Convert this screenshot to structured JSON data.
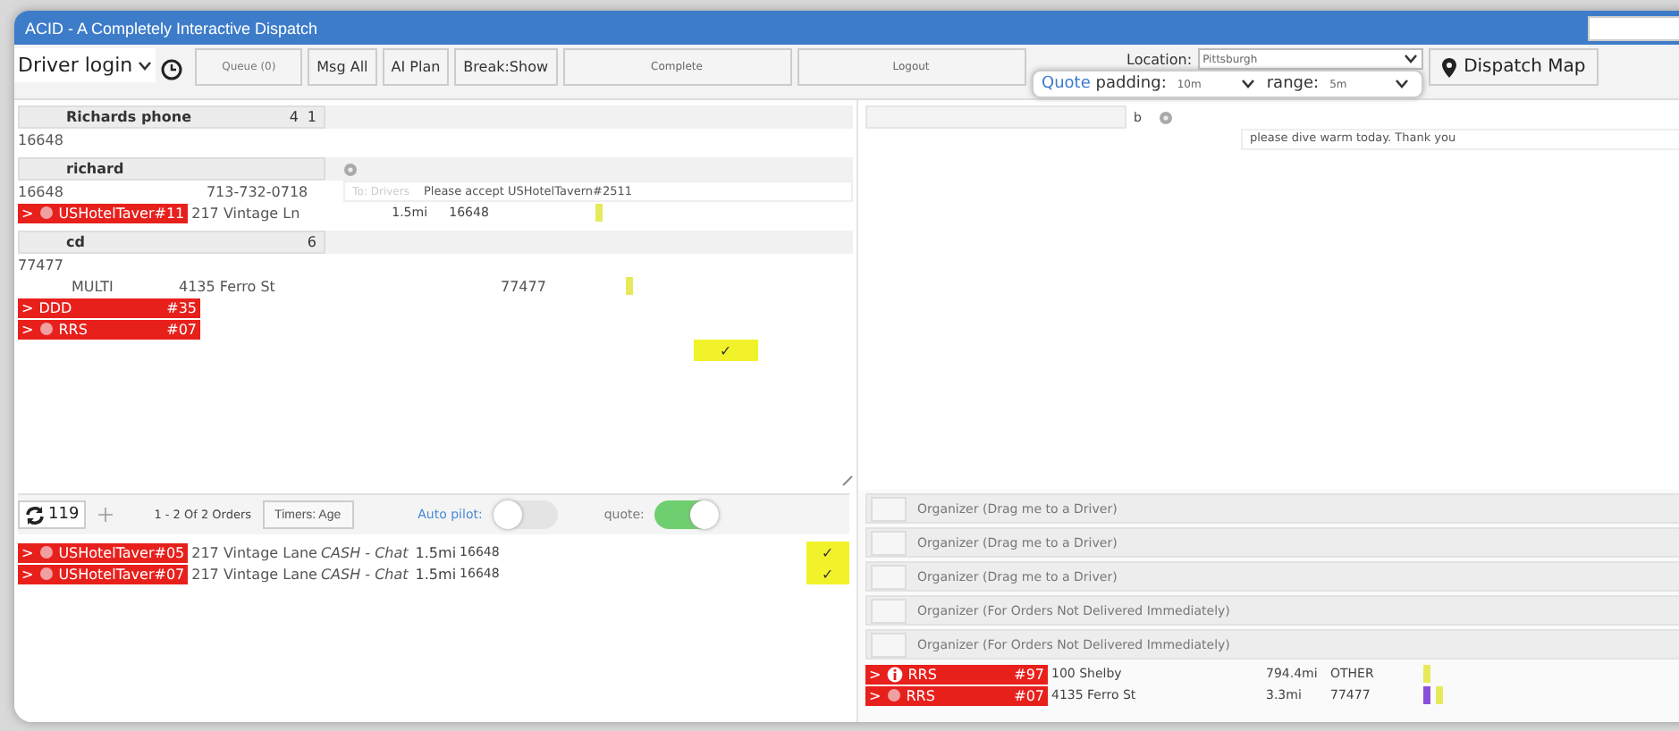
{
  "window": {
    "title": "ACID - A Completely Interactive Dispatch"
  },
  "toolbar": {
    "driver_login": "Driver login",
    "buttons": [
      {
        "label": "Queue (0)",
        "kind": "faint"
      },
      {
        "label": "Msg All",
        "kind": "plain"
      },
      {
        "label": "AI Plan",
        "kind": "plain"
      },
      {
        "label": "Break:Show",
        "kind": "plain"
      },
      {
        "label": "Complete",
        "kind": "wide"
      },
      {
        "label": "Logout",
        "kind": "wide"
      }
    ],
    "location_label": "Location:",
    "location_value": "Pittsburgh",
    "map_button": "Dispatch Map",
    "quote_word": "Quote",
    "padding_label": "padding:",
    "padding_value": "10m",
    "range_label": "range:",
    "range_value": "5m"
  },
  "drivers": [
    {
      "name": "Richards phone",
      "counts": [
        "4",
        "1"
      ],
      "lines": [
        {
          "cells": [
            "16648"
          ]
        }
      ]
    },
    {
      "name": "richard",
      "lines": [
        {
          "cells": [
            "16648",
            "713-732-0718"
          ]
        }
      ],
      "message": {
        "from": "To: Drivers",
        "text": "Please accept USHotelTavern#2511"
      },
      "orders": [
        {
          "arrow": ">",
          "kind": "dot",
          "tag": "USHotelTaver#11",
          "address": "217 Vintage Ln",
          "distance": "1.5mi",
          "zip": "16648",
          "flags": [
            {
              "color": "#e6ea5a"
            }
          ]
        }
      ]
    },
    {
      "name": "cd",
      "counts": [
        "6"
      ],
      "lines": [
        {
          "cells": [
            "77477"
          ]
        },
        {
          "cells": [
            "MULTI",
            "4135 Ferro St",
            "77477"
          ],
          "flags": [
            {
              "color": "#e6ea5a"
            }
          ]
        }
      ],
      "orders": [
        {
          "arrow": ">",
          "kind": "plain",
          "tag": "DDD",
          "number": "#35"
        },
        {
          "arrow": ">",
          "kind": "dot",
          "tag": "RRS",
          "number": "#07"
        }
      ],
      "check": "✓"
    }
  ],
  "chat": {
    "b": "b",
    "message": "please dive warm today. Thank you"
  },
  "orders_bar": {
    "refresh_count": "119",
    "pager": "1 - 2 Of 2 Orders",
    "timers": "Timers: Age",
    "toggles": [
      {
        "label": "Auto pilot:",
        "on": false
      },
      {
        "label": "quote:",
        "on": true
      }
    ]
  },
  "orders": [
    {
      "arrow": ">",
      "kind": "dot",
      "tag": "USHotelTaver#05",
      "address": "217 Vintage Lane",
      "payment": "CASH - Chat",
      "distance": "1.5mi",
      "zip": "16648",
      "check": "✓"
    },
    {
      "arrow": ">",
      "kind": "dot",
      "tag": "USHotelTaver#07",
      "address": "217 Vintage Lane",
      "payment": "CASH - Chat",
      "distance": "1.5mi",
      "zip": "16648",
      "check": "✓"
    }
  ],
  "organizers": [
    {
      "label": "Organizer (Drag me to a Driver)",
      "checked": false
    },
    {
      "label": "Organizer (Drag me to a Driver)",
      "checked": false
    },
    {
      "label": "Organizer (Drag me to a Driver)",
      "checked": false
    },
    {
      "label": "Organizer (For Orders Not Delivered Immediately)",
      "checked": false
    },
    {
      "label": "Organizer (For Orders Not Delivered Immediately)",
      "checked": false
    }
  ],
  "organizer_orders": [
    {
      "arrow": ">",
      "kind": "info",
      "tag": "RRS",
      "number": "#97",
      "address": "100 Shelby",
      "distance": "794.4mi",
      "zip": "OTHER",
      "flags": [
        {
          "color": "#e6ea5a"
        }
      ]
    },
    {
      "arrow": ">",
      "kind": "dot",
      "tag": "RRS",
      "number": "#07",
      "address": "4135 Ferro St",
      "distance": "3.3mi",
      "zip": "77477",
      "flags": [
        {
          "color": "#8a4fd8"
        },
        {
          "color": "#e6ea5a"
        }
      ]
    }
  ]
}
